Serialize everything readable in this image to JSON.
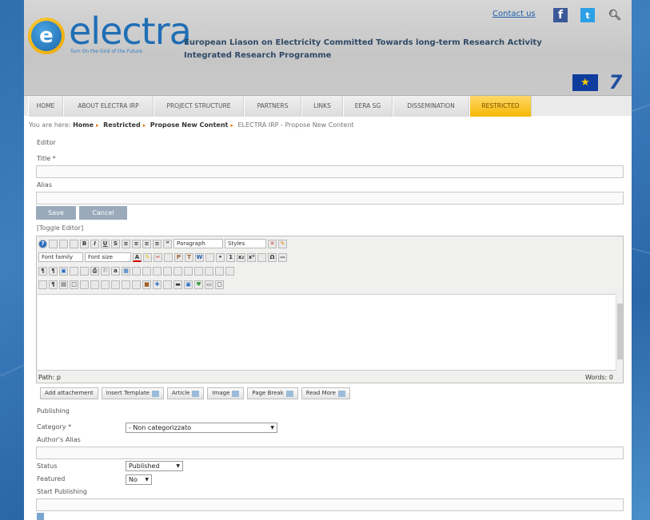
{
  "header": {
    "logo_letter": "e",
    "logo_text": "electra",
    "tagline": "Turn On the Grid of the Future",
    "title_line1": "European Liason on Electricity Committed Towards long-term Research Activity",
    "title_line2": "Integrated Research Programme",
    "contact": "Contact us",
    "fb": "f",
    "tw": "t",
    "fp7": "7"
  },
  "nav": {
    "items": [
      {
        "label": "HOME"
      },
      {
        "label": "ABOUT ELECTRA IRP"
      },
      {
        "label": "PROJECT STRUCTURE"
      },
      {
        "label": "PARTNERS"
      },
      {
        "label": "LINKS"
      },
      {
        "label": "EERA SG"
      },
      {
        "label": "DISSEMINATION"
      },
      {
        "label": "RESTRICTED"
      }
    ]
  },
  "breadcrumb": {
    "prefix": "You are here:",
    "items": [
      "Home",
      "Restricted",
      "Propose New Content"
    ],
    "current": "ELECTRA IRP - Propose New Content"
  },
  "form": {
    "editor_heading": "Editor",
    "title_label": "Title *",
    "title_value": "",
    "alias_label": "Alias",
    "alias_value": "",
    "save": "Save",
    "cancel": "Cancel",
    "toggle_editor": "[Toggle Editor]"
  },
  "toolbar": {
    "paragraph": "Paragraph",
    "styles": "Styles",
    "font_family": "Font family",
    "font_size": "Font size"
  },
  "editor": {
    "path": "Path: p",
    "words": "Words: 0"
  },
  "extra_buttons": {
    "add_attachment": "Add attachement",
    "insert_template": "Insert Template",
    "article": "Article",
    "image": "Image",
    "page_break": "Page Break",
    "read_more": "Read More"
  },
  "publishing": {
    "heading": "Publishing",
    "category_label": "Category *",
    "category_value": "- Non categorizzato",
    "authors_alias_label": "Author's Alias",
    "authors_alias_value": "",
    "status_label": "Status",
    "status_value": "Published",
    "featured_label": "Featured",
    "featured_value": "No",
    "start_publishing_label": "Start Publishing",
    "start_publishing_value": ""
  }
}
